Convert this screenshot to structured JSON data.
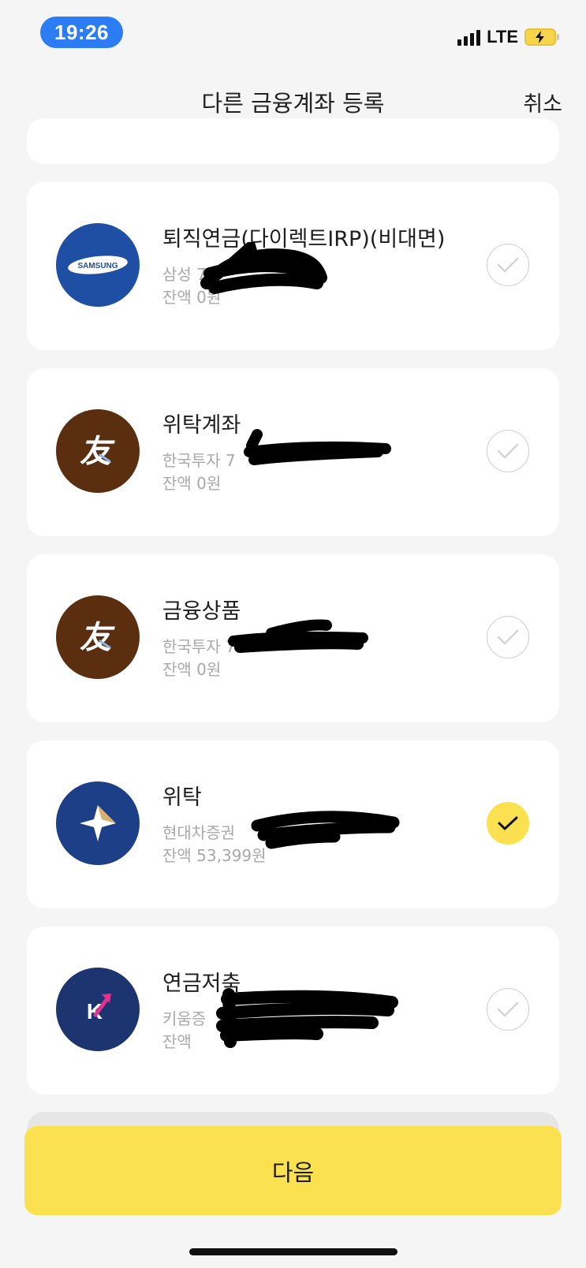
{
  "status_bar": {
    "time": "19:26",
    "network": "LTE"
  },
  "header": {
    "title": "다른 금융계좌 등록",
    "cancel_label": "취소"
  },
  "accounts": [
    {
      "name": "퇴직연금(다이렉트IRP)(비대면)",
      "institution_visible": "삼성 71",
      "balance": "잔액 0원",
      "logo": "samsung-logo",
      "logo_text": "SAMSUNG",
      "selected": false
    },
    {
      "name": "위탁계좌",
      "institution_visible": "한국투자 7",
      "balance": "잔액 0원",
      "logo": "korea-investment-logo",
      "logo_text": "友",
      "selected": false
    },
    {
      "name": "금융상품",
      "institution_visible": "한국투자 7",
      "balance": "잔액 0원",
      "logo": "korea-investment-logo",
      "logo_text": "友",
      "selected": false
    },
    {
      "name": "위탁",
      "institution_visible": "현대차증권",
      "balance": "잔액 53,399원",
      "logo": "hyundai-motor-securities-logo",
      "selected": true
    },
    {
      "name": "연금저축",
      "institution_visible": "키움증",
      "balance": "잔액",
      "logo": "kiwoom-logo",
      "logo_text": "K",
      "selected": false
    }
  ],
  "footer": {
    "next_label": "다음"
  },
  "colors": {
    "accent_yellow": "#fbe14f",
    "time_pill_blue": "#2c7cf6",
    "samsung_blue": "#1e4fa5",
    "korea_investment_brown": "#5b2e0f",
    "hyundai_navy": "#1d3f87",
    "kiwoom_navy": "#1c3570"
  }
}
